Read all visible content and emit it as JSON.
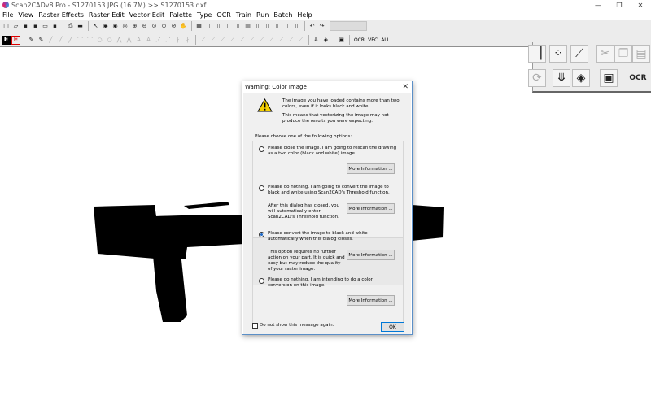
{
  "window": {
    "title": "Scan2CADv8 Pro  -  S1270153.JPG (16.7M) >> S1270153.dxf",
    "controls": [
      "—",
      "❐",
      "✕"
    ]
  },
  "menu": [
    "File",
    "View",
    "Raster Effects",
    "Raster Edit",
    "Vector Edit",
    "Palette",
    "Type",
    "OCR",
    "Train",
    "Run",
    "Batch",
    "Help"
  ],
  "toolbar2": {
    "e_black": "E",
    "e_red": "E",
    "ocr_label": "OCR",
    "vec_label": "VEC",
    "all_label": "ALL"
  },
  "palette": {
    "ocr_label": "OCR"
  },
  "colors": {
    "dialog_border": "#5b8fc7",
    "warning_yellow": "#f5d000",
    "radio_selected": "#1a66c4",
    "ok_border": "#0078d7"
  },
  "dialog": {
    "title": "Warning: Color Image",
    "close_glyph": "✕",
    "icon": "warning-icon",
    "message1": "The image you have loaded contains more than two colors, even if it looks black and white.",
    "message2": "This means that vectorizing the image may not produce the results you were expecting.",
    "choose_label": "Please choose one of the following options:",
    "options": [
      {
        "text": "Please close the image. I am going to rescan the drawing as a two color (black and white) image.",
        "button": "More Information ...",
        "selected": false
      },
      {
        "text": "Please do nothing. I am going to convert the image to black and white using Scan2CAD's Threshold function.",
        "note": "After this dialog has closed, you will automatically enter Scan2CAD's Threshold function.",
        "button": "More Information ...",
        "selected": false
      },
      {
        "text": "Please convert the image to black and white automatically when this dialog closes.",
        "note": "This option requires no further action on your part. It is quick and easy but may reduce the quality of your raster image.",
        "button": "More Information ...",
        "selected": true
      },
      {
        "text": "Please do nothing. I am intending to do a color conversion on this image.",
        "button": "More Information ...",
        "selected": false
      }
    ],
    "checkbox_label": "Do not show this message again.",
    "ok_label": "OK"
  }
}
